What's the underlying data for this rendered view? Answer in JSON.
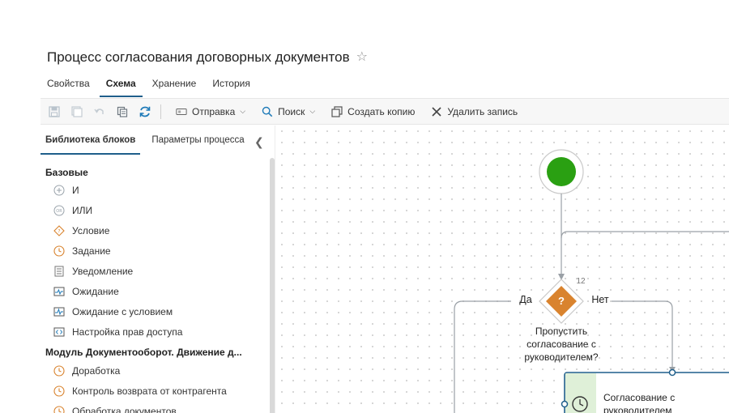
{
  "header": {
    "title": "Процесс согласования договорных документов",
    "star_icon": "star-outline-icon"
  },
  "tabs": [
    {
      "label": "Свойства",
      "active": false
    },
    {
      "label": "Схема",
      "active": true
    },
    {
      "label": "Хранение",
      "active": false
    },
    {
      "label": "История",
      "active": false
    }
  ],
  "toolbar": {
    "send_label": "Отправка",
    "search_label": "Поиск",
    "copy_label": "Создать копию",
    "delete_label": "Удалить запись"
  },
  "left_panel": {
    "tabs": [
      {
        "label": "Библиотека блоков",
        "active": true
      },
      {
        "label": "Параметры процесса",
        "active": false
      }
    ],
    "sections": [
      {
        "title": "Базовые",
        "items": [
          {
            "label": "И",
            "icon": "and-gateway-icon"
          },
          {
            "label": "ИЛИ",
            "icon": "or-gateway-icon"
          },
          {
            "label": "Условие",
            "icon": "condition-icon"
          },
          {
            "label": "Задание",
            "icon": "clock-task-icon"
          },
          {
            "label": "Уведомление",
            "icon": "notification-icon"
          },
          {
            "label": "Ожидание",
            "icon": "wait-icon"
          },
          {
            "label": "Ожидание с условием",
            "icon": "wait-condition-icon"
          },
          {
            "label": "Настройка прав доступа",
            "icon": "access-rights-icon"
          }
        ]
      },
      {
        "title": "Модуль Документооборот. Движение д...",
        "items": [
          {
            "label": "Доработка",
            "icon": "clock-task-icon"
          },
          {
            "label": "Контроль возврата от контрагента",
            "icon": "clock-task-icon"
          },
          {
            "label": "Обработка документов",
            "icon": "clock-task-icon"
          }
        ]
      }
    ]
  },
  "diagram": {
    "condition": {
      "number": "12",
      "symbol": "?",
      "yes_label": "Да",
      "no_label": "Нет",
      "text_lines": [
        "Пропустить",
        "согласование с",
        "руководителем?"
      ]
    },
    "task": {
      "text_lines": [
        "Согласование с",
        "руководителем"
      ]
    }
  },
  "colors": {
    "accent": "#1f5f8b",
    "start_green": "#2aa012",
    "condition_orange": "#d9832e",
    "task_fill": "#dff0d8",
    "toolbar_blue": "#1e7ab8"
  }
}
